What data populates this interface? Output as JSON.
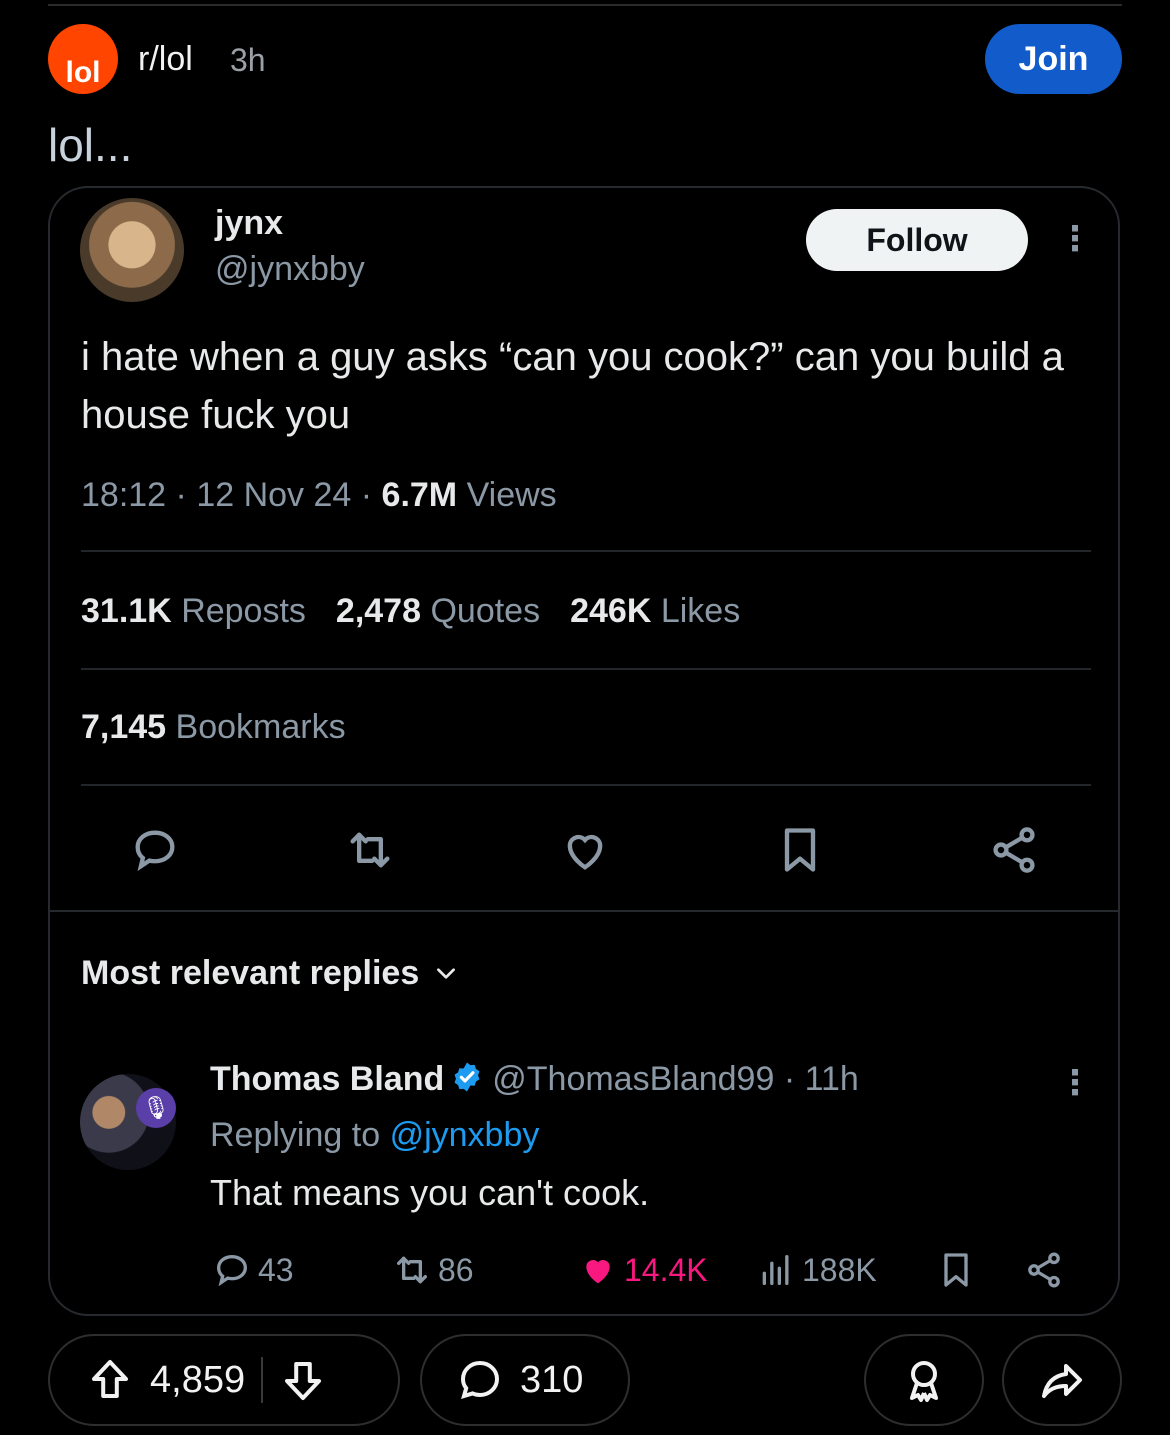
{
  "post": {
    "subreddit_avatar_text": "lol",
    "subreddit": "r/lol",
    "age": "3h",
    "join_label": "Join",
    "title": "lol..."
  },
  "tweet": {
    "name": "jynx",
    "handle": "@jynxbby",
    "follow_label": "Follow",
    "text": "i hate when a guy asks “can you cook?” can you build a house fuck you",
    "time": "18:12",
    "date": "12 Nov 24",
    "views_count": "6.7M",
    "views_label": "Views",
    "reposts_count": "31.1K",
    "reposts_label": "Reposts",
    "quotes_count": "2,478",
    "quotes_label": "Quotes",
    "likes_count": "246K",
    "likes_label": "Likes",
    "bookmarks_count": "7,145",
    "bookmarks_label": "Bookmarks",
    "actions": [
      "reply-icon",
      "repost-icon",
      "like-icon",
      "bookmark-icon",
      "share-icon"
    ]
  },
  "replies": {
    "sort_label": "Most relevant replies",
    "reply": {
      "name": "Thomas Bland",
      "handle": "@ThomasBland99",
      "age": "11h",
      "replying_prefix": "Replying to",
      "replying_to": "@jynxbby",
      "text": "That means you can't cook.",
      "replies": "43",
      "reposts": "86",
      "likes": "14.4K",
      "views": "188K"
    }
  },
  "footer": {
    "votes": "4,859",
    "comments": "310"
  },
  "colors": {
    "reddit_orange": "#ff4500",
    "join_blue": "#115bca",
    "twitter_blue": "#1d9bf0",
    "like_pink": "#f91880"
  }
}
